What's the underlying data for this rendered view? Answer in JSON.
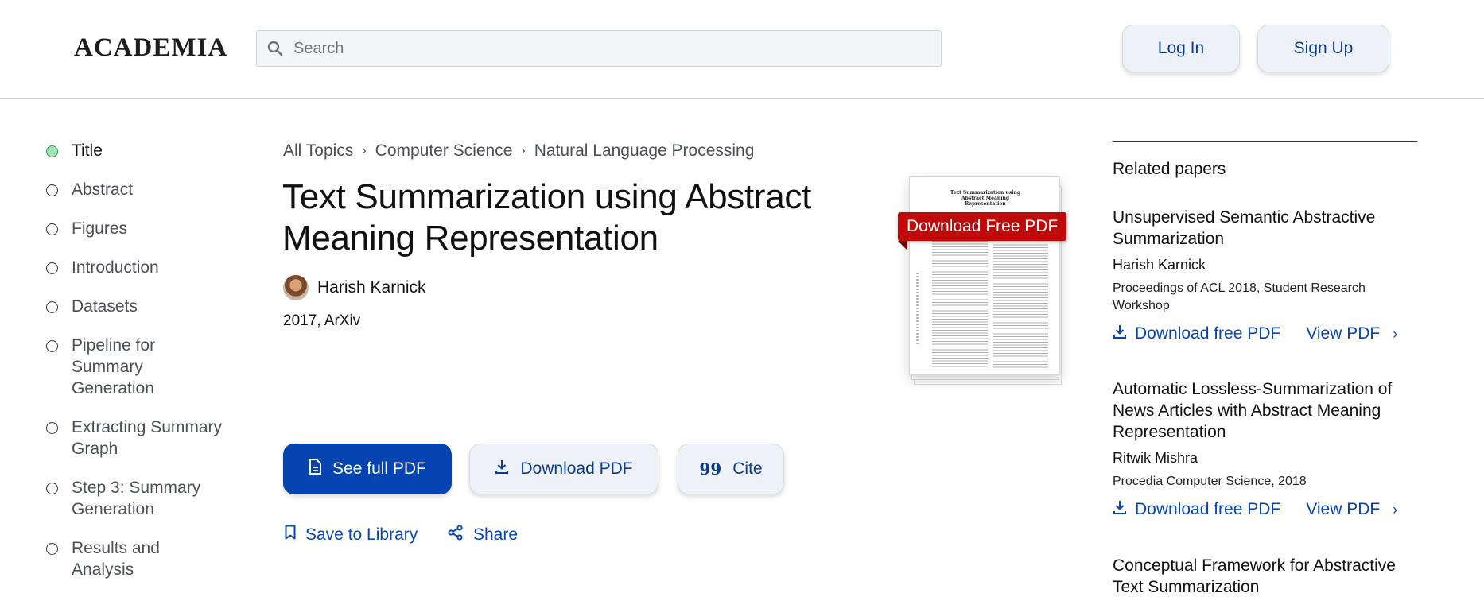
{
  "header": {
    "logo": "ACADEMIA",
    "search_placeholder": "Search",
    "login_label": "Log In",
    "signup_label": "Sign Up"
  },
  "toc": [
    {
      "label": "Title",
      "active": true
    },
    {
      "label": "Abstract"
    },
    {
      "label": "Figures"
    },
    {
      "label": "Introduction"
    },
    {
      "label": "Datasets"
    },
    {
      "label": "Pipeline for Summary Generation"
    },
    {
      "label": "Extracting Summary Graph"
    },
    {
      "label": "Step 3: Summary Generation"
    },
    {
      "label": "Results and Analysis"
    }
  ],
  "breadcrumb": [
    "All Topics",
    "Computer Science",
    "Natural Language Processing"
  ],
  "paper": {
    "title": "Text Summarization using Abstract Meaning Representation",
    "author": "Harish Karnick",
    "meta": "2017, ArXiv"
  },
  "actions": {
    "full_pdf": "See full PDF",
    "download_pdf": "Download PDF",
    "cite": "Cite",
    "cite_glyph": "99",
    "save": "Save to Library",
    "share": "Share"
  },
  "thumbnail": {
    "ribbon": "Download Free PDF",
    "page_title": "Text Summarization using Abstract Meaning Representation"
  },
  "related": {
    "heading": "Related papers",
    "items": [
      {
        "title": "Unsupervised Semantic Abstractive Summarization",
        "author": "Harish Karnick",
        "venue": "Proceedings of ACL 2018, Student Research Workshop",
        "download": "Download free PDF",
        "view": "View PDF"
      },
      {
        "title": "Automatic Lossless-Summarization of News Articles with Abstract Meaning Representation",
        "author": "Ritwik Mishra",
        "venue": "Procedia Computer Science, 2018",
        "download": "Download free PDF",
        "view": "View PDF"
      },
      {
        "title": "Conceptual Framework for Abstractive Text Summarization"
      }
    ]
  },
  "colors": {
    "brand_blue": "#0645b1",
    "ribbon_red": "#c00a0a",
    "active_dot": "#a6e3b8"
  }
}
